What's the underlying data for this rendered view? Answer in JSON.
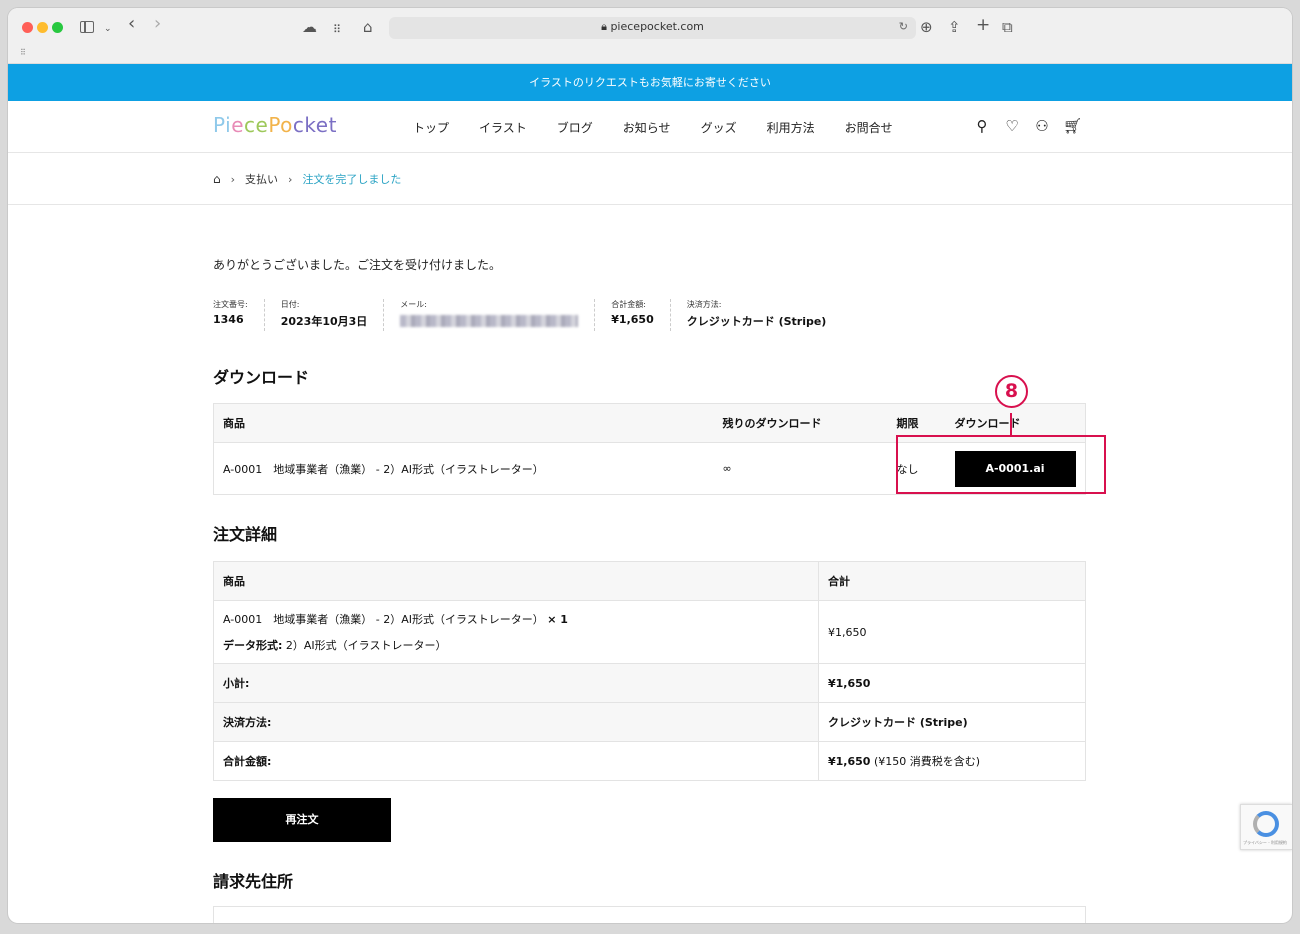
{
  "browser": {
    "url": "piecepocket.com",
    "icons": [
      "sidebar-icon",
      "chevron-down-icon",
      "back-icon",
      "forward-icon",
      "cloud-icon",
      "grid-icon",
      "home-icon",
      "reload-icon",
      "download-icon",
      "share-icon",
      "plus-icon",
      "tabs-icon"
    ]
  },
  "banner": {
    "text": "イラストのリクエストもお気軽にお寄せください"
  },
  "header": {
    "logo": [
      "Pi",
      "e",
      "ce",
      "Po",
      "cket"
    ],
    "nav": [
      "トップ",
      "イラスト",
      "ブログ",
      "お知らせ",
      "グッズ",
      "利用方法",
      "お問合せ"
    ],
    "icons": [
      "search-icon",
      "heart-icon",
      "user-icon",
      "cart-icon"
    ]
  },
  "breadcrumb": {
    "items": [
      "支払い",
      "注文を完了しました"
    ]
  },
  "order": {
    "thanks": "ありがとうございました。ご注文を受け付けました。",
    "number_label": "注文番号:",
    "number": "1346",
    "date_label": "日付:",
    "date": "2023年10月3日",
    "email_label": "メール:",
    "total_label": "合計金額:",
    "total": "¥1,650",
    "payment_label": "決済方法:",
    "payment": "クレジットカード (Stripe)"
  },
  "downloads": {
    "title": "ダウンロード",
    "headers": [
      "商品",
      "残りのダウンロード",
      "期限",
      "ダウンロード"
    ],
    "row": {
      "product": "A-0001　地域事業者（漁業） - 2）AI形式（イラストレーター）",
      "remaining": "∞",
      "expires": "なし",
      "file": "A-0001.ai"
    },
    "annotation": "8"
  },
  "details": {
    "title": "注文詳細",
    "headers": [
      "商品",
      "合計"
    ],
    "item_line1": "A-0001　地域事業者（漁業） - 2）AI形式（イラストレーター）",
    "item_qty": "× 1",
    "item_meta_label": "データ形式:",
    "item_meta_value": "2）AI形式（イラストレーター）",
    "item_total": "¥1,650",
    "subtotal_label": "小計:",
    "subtotal": "¥1,650",
    "payment_label": "決済方法:",
    "payment": "クレジットカード (Stripe)",
    "total_label": "合計金額:",
    "total": "¥1,650",
    "total_note": "(¥150 消費税を含む)"
  },
  "reorder_label": "再注文",
  "billing": {
    "title": "請求先住所"
  },
  "recaptcha": {
    "text": "プライバシー - 利用規約"
  },
  "colors": {
    "banner": "#0da0e3",
    "highlight": "#d8104e",
    "breadcrumb_current": "#2aa3c4"
  }
}
